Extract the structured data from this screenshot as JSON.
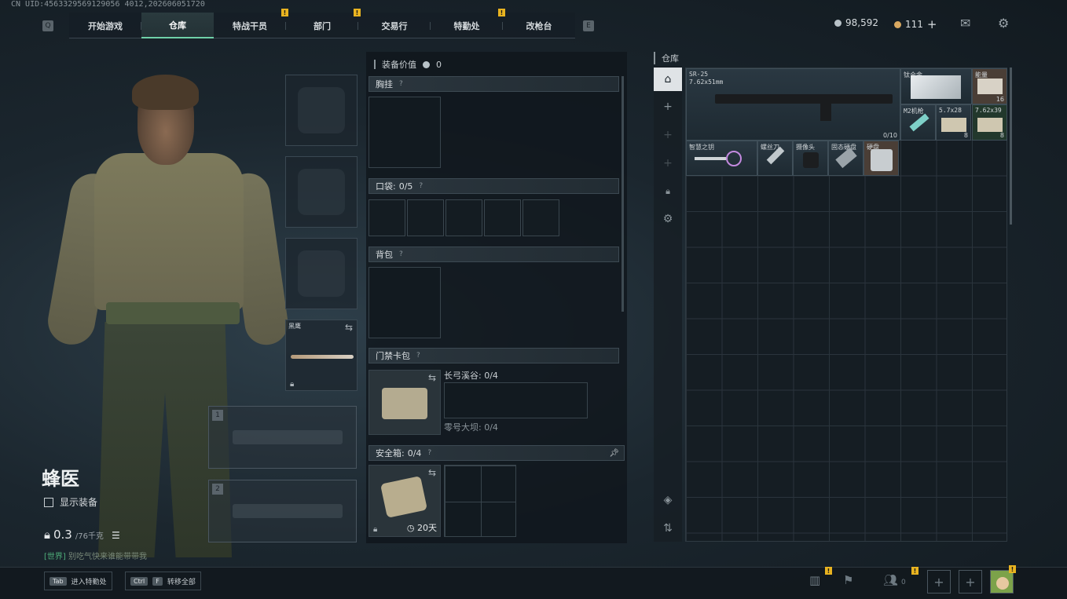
{
  "uid": "CN UID:4563329569129056 4012,202606051720",
  "nav": {
    "left_key": "Q",
    "right_key": "E",
    "tabs": [
      {
        "label": "开始游戏",
        "badge": ""
      },
      {
        "label": "仓库",
        "badge": ""
      },
      {
        "label": "特战干员",
        "badge": "!"
      },
      {
        "label": "部门",
        "badge": "!"
      },
      {
        "label": "交易行",
        "badge": ""
      },
      {
        "label": "特勤处",
        "badge": "!"
      },
      {
        "label": "改枪台",
        "badge": ""
      }
    ],
    "active_tab": "仓库"
  },
  "currency": {
    "silver": "98,592",
    "gold": "111",
    "gold_add": "+"
  },
  "character": {
    "name": "蜂医",
    "show_equipment_label": "显示装备",
    "weight_value": "0.3",
    "weight_max": "/76千克",
    "chat_channel": "[世界]",
    "chat_text": "别吃气快来谁能带带我"
  },
  "equip_slots": {
    "melee_label": "黑鹰"
  },
  "weapon_slots": [
    "1",
    "2"
  ],
  "middle": {
    "equipment_value_label": "装备价值",
    "equipment_value": "0",
    "chest_rig": "胸挂",
    "pocket_label": "口袋:",
    "pocket_value": "0/5",
    "backpack": "背包",
    "keycard_bag": "门禁卡包",
    "keycard_long": "长弓溪谷: 0/4",
    "keycard_zero": "零号大坝: 0/4",
    "safe_box_label": "安全箱:",
    "safe_box_value": "0/4",
    "safe_box_timer": "20天",
    "help": "?"
  },
  "warehouse": {
    "title": "仓库",
    "items": [
      {
        "name": "SR-25",
        "sub": "7.62x51mm",
        "count": "0/10"
      },
      {
        "name": "钛合金",
        "count": ""
      },
      {
        "name": "能量",
        "count": "16"
      },
      {
        "name": "M2机枪",
        "count": ""
      },
      {
        "name": "5.7x28",
        "count": "8"
      },
      {
        "name": "7.62x39",
        "count": "8"
      },
      {
        "name": "智慧之钥",
        "count": ""
      },
      {
        "name": "螺丝刀",
        "count": ""
      },
      {
        "name": "摄像头",
        "count": ""
      },
      {
        "name": "固态硬盘",
        "count": ""
      },
      {
        "name": "硬盘",
        "count": ""
      }
    ]
  },
  "bottom": {
    "hint1_key": "Tab",
    "hint1_label": "进入特勤处",
    "hint2_key1": "Ctrl",
    "hint2_key2": "F",
    "hint2_label": "转移全部",
    "friends_count": "0",
    "badge": "!"
  }
}
